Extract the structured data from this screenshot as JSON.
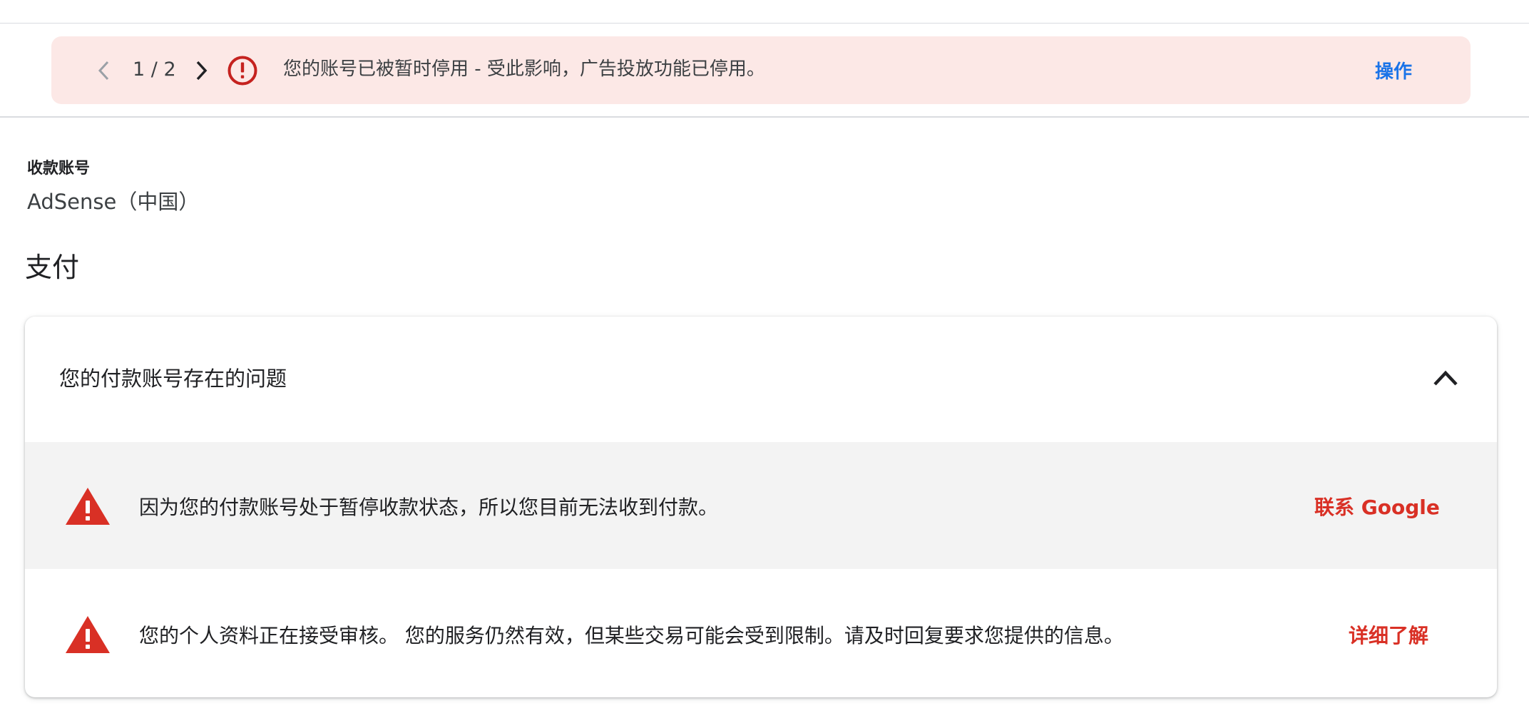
{
  "banner": {
    "pager": "1 / 2",
    "message": "您的账号已被暂时停用 - 受此影响，广告投放功能已停用。",
    "action_label": "操作",
    "icon": "error-circle-icon",
    "background_color": "#fce8e6",
    "icon_color": "#c5221f",
    "action_color": "#1a73e8"
  },
  "account": {
    "label": "收款账号",
    "value": "AdSense（中国）"
  },
  "section": {
    "title": "支付"
  },
  "issues_card": {
    "title": "您的付款账号存在的问题",
    "collapse_icon": "chevron-up-icon",
    "items": [
      {
        "icon": "warning-triangle-icon",
        "text": "因为您的付款账号处于暂停收款状态，所以您目前无法收到付款。",
        "link_label": "联系 Google"
      },
      {
        "icon": "warning-triangle-icon",
        "text": "您的个人资料正在接受审核。 您的服务仍然有效，但某些交易可能会受到限制。请及时回复要求您提供的信息。",
        "link_label": "详细了解"
      }
    ],
    "warning_color": "#d93025"
  }
}
